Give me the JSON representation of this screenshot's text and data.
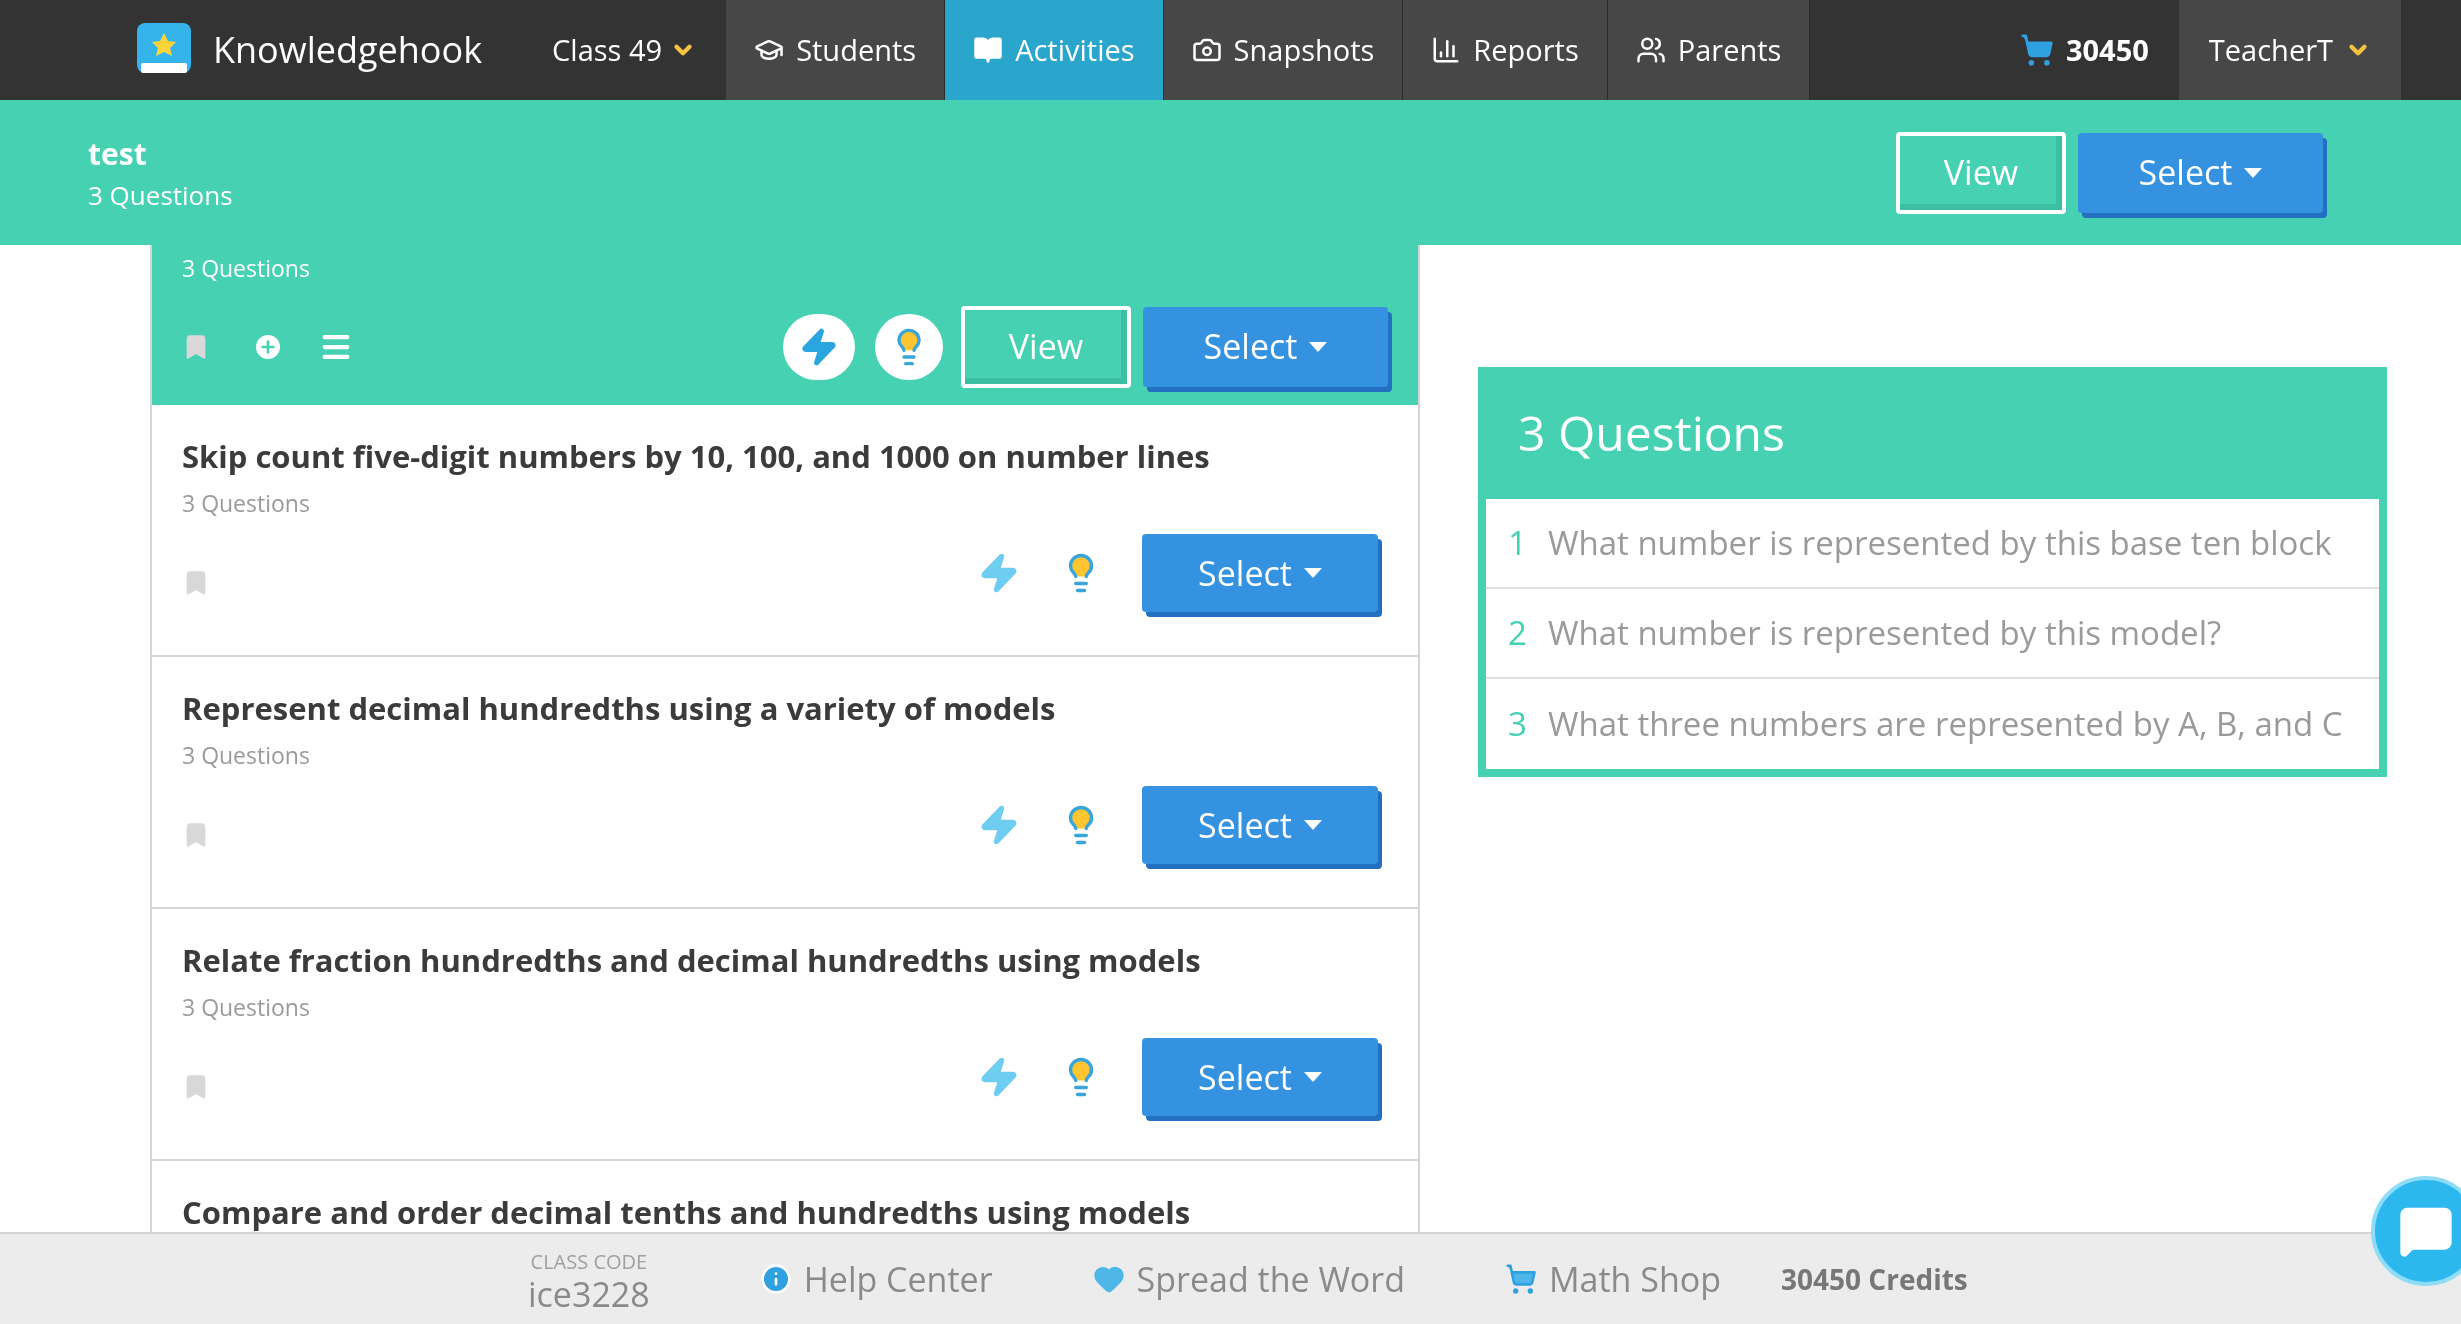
{
  "nav": {
    "brand": "Knowledgehook",
    "class_menu": "Class 49",
    "tabs": [
      {
        "label": "Students",
        "kind": "students",
        "selected": false
      },
      {
        "label": "Activities",
        "kind": "activities",
        "selected": true
      },
      {
        "label": "Snapshots",
        "kind": "snapshots",
        "selected": false
      },
      {
        "label": "Reports",
        "kind": "reports",
        "selected": false
      },
      {
        "label": "Parents",
        "kind": "parents",
        "selected": false
      }
    ],
    "cart_count": "30450",
    "user_menu": "TeacherT"
  },
  "header": {
    "title": "test",
    "subtitle": "3 Questions",
    "view_button": "View",
    "select_button": "Select"
  },
  "top_card": {
    "subtitle": "3 Questions",
    "view_button": "View",
    "select_button": "Select"
  },
  "activities": [
    {
      "title": "Skip count five-digit numbers by 10, 100, and 1000 on number lines",
      "subtitle": "3 Questions",
      "select_button": "Select"
    },
    {
      "title": "Represent decimal hundredths using a variety of models",
      "subtitle": "3 Questions",
      "select_button": "Select"
    },
    {
      "title": "Relate fraction hundredths and decimal hundredths using models",
      "subtitle": "3 Questions",
      "select_button": "Select"
    },
    {
      "title": "Compare and order decimal tenths and hundredths using models"
    }
  ],
  "questions_panel": {
    "title": "3 Questions",
    "questions": [
      {
        "number": "1",
        "text": "What number is represented by this base ten block"
      },
      {
        "number": "2",
        "text": "What number is represented by this model?"
      },
      {
        "number": "3",
        "text": "What three numbers are represented by A, B, and C"
      }
    ]
  },
  "footer": {
    "class_code_label": "CLASS CODE",
    "class_code": "ice3228",
    "links": [
      {
        "label": "Help Center",
        "kind": "info"
      },
      {
        "label": "Spread the Word",
        "kind": "heart"
      },
      {
        "label": "Math Shop",
        "kind": "cart"
      }
    ],
    "credits": "30450 Credits"
  }
}
